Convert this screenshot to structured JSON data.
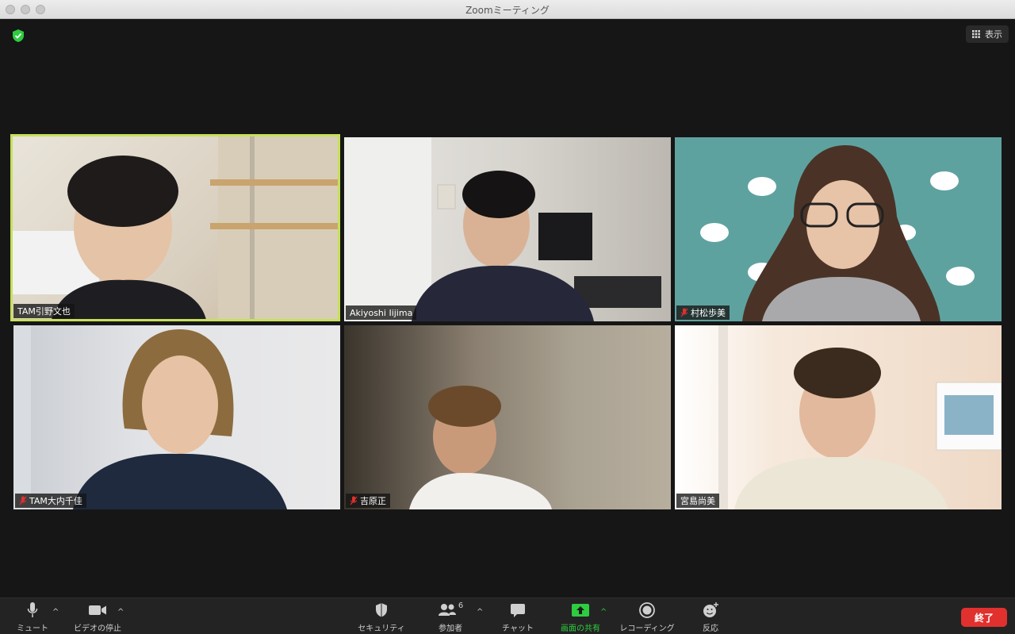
{
  "window": {
    "title": "Zoomミーティング"
  },
  "top": {
    "view_label": "表示"
  },
  "participants": [
    {
      "name": "TAM引野文也",
      "muted": false,
      "active": true
    },
    {
      "name": "Akiyoshi Iijima",
      "muted": false,
      "active": false
    },
    {
      "name": "村松歩美",
      "muted": true,
      "active": false
    },
    {
      "name": "TAM大内千佳",
      "muted": true,
      "active": false
    },
    {
      "name": "吉原正",
      "muted": true,
      "active": false
    },
    {
      "name": "宮島尚美",
      "muted": false,
      "active": false
    }
  ],
  "toolbar": {
    "mute_label": "ミュート",
    "video_label": "ビデオの停止",
    "security_label": "セキュリティ",
    "participants_label": "参加者",
    "participants_count": "6",
    "chat_label": "チャット",
    "share_label": "画面の共有",
    "record_label": "レコーディング",
    "reactions_label": "反応",
    "end_label": "終了"
  },
  "colors": {
    "active_border": "#c6e05a",
    "share_green": "#2ecc40",
    "end_red": "#e0312e",
    "mute_red": "#e0312e"
  }
}
